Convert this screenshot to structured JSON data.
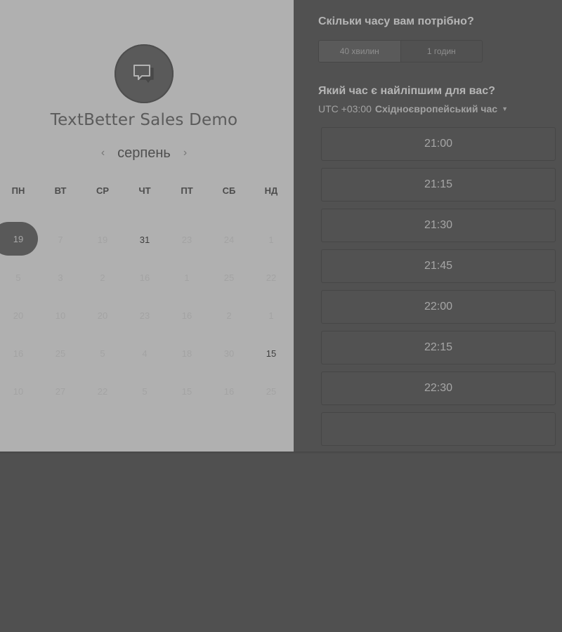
{
  "company": {
    "name": "TextBetter Sales Demo",
    "logo_icon": "chat-bubble-icon"
  },
  "calendar": {
    "month": "серпень",
    "prev_icon": "‹",
    "next_icon": "›",
    "weekdays": [
      "ПН",
      "ВТ",
      "СР",
      "ЧТ",
      "ПТ",
      "СБ",
      "НД"
    ],
    "weeks": [
      [
        "19",
        "7",
        "19",
        "31",
        "23",
        "24",
        "1"
      ],
      [
        "5",
        "3",
        "2",
        "16",
        "1",
        "25",
        "22"
      ],
      [
        "20",
        "10",
        "20",
        "23",
        "16",
        "2",
        "1"
      ],
      [
        "16",
        "25",
        "5",
        "4",
        "18",
        "30",
        "15"
      ],
      [
        "10",
        "27",
        "22",
        "5",
        "15",
        "16",
        "25"
      ]
    ],
    "selected_day": "19",
    "available_days": [
      "31",
      "15"
    ]
  },
  "duration": {
    "title": "Скільки часу вам потрібно?",
    "options": [
      "40 хвилин",
      "1 годин"
    ],
    "selected": "40 хвилин"
  },
  "time_picker": {
    "title": "Який час є найліпшим для вас?",
    "timezone_offset": "UTC +03:00",
    "timezone_name": "Східноєвропейський час",
    "slots": [
      "21:00",
      "21:15",
      "21:30",
      "21:45",
      "22:00",
      "22:15",
      "22:30"
    ]
  },
  "colors": {
    "left_panel_bg": "#b0b0b0",
    "right_panel_bg": "#515151",
    "selected_day_bg": "#595959"
  }
}
